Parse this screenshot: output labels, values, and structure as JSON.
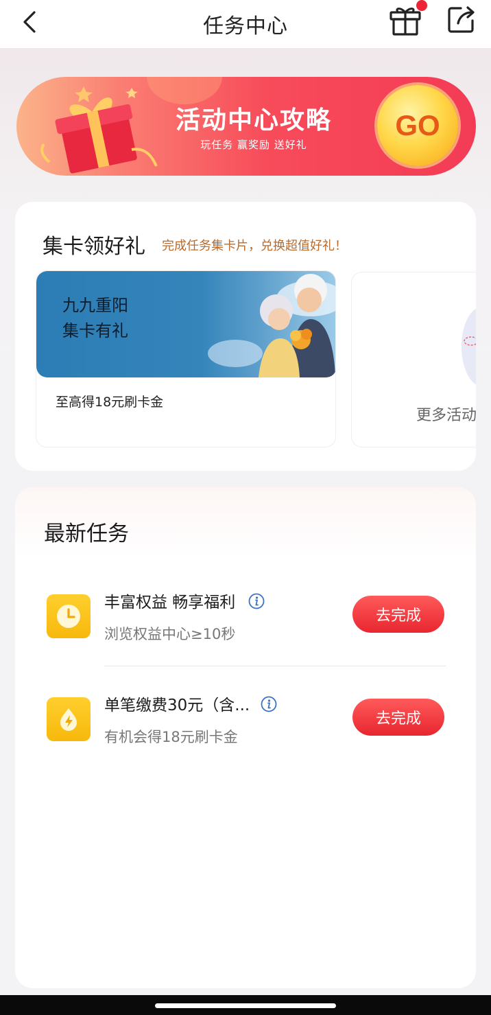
{
  "header": {
    "title": "任务中心",
    "back_icon": "chevron-left-icon",
    "gift_icon": "gift-icon",
    "share_icon": "share-icon",
    "badge_color": "#ee2436"
  },
  "banner": {
    "title": "活动中心攻略",
    "subtitle": "玩任务 赢奖励 送好礼",
    "go_label": "GO",
    "accent": "#f33b55"
  },
  "collect": {
    "title": "集卡领好礼",
    "subtitle": "完成任务集卡片，兑换超值好礼！",
    "activity": {
      "image_title_line1": "九九重阳",
      "image_title_line2": "集卡有礼",
      "reward": "至高得18元刷卡金"
    },
    "more_label": "更多活动"
  },
  "tasks": {
    "title": "最新任务",
    "items": [
      {
        "name": "丰富权益 畅享福利",
        "desc": "浏览权益中心≥10秒",
        "button": "去完成",
        "icon": "clock-icon"
      },
      {
        "name": "单笔缴费30元（含...",
        "desc": "有机会得18元刷卡金",
        "button": "去完成",
        "icon": "energy-drop-icon"
      }
    ]
  }
}
